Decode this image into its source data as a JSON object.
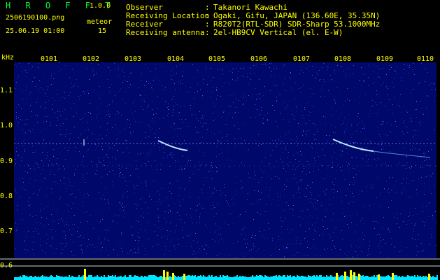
{
  "header": {
    "app_title": "H R O F F T",
    "version": "1.0.0",
    "filename": "2506190100.png",
    "meteor_label": "meteor",
    "datetime": "25.06.19 01:00",
    "meteor_count": "15",
    "info": [
      {
        "key": "Observer",
        "value": "Takanori Kawachi"
      },
      {
        "key": "Receiving Location",
        "value": "Ogaki, Gifu, JAPAN (136.60E, 35.35N)"
      },
      {
        "key": "Receiver",
        "value": "R820T2(RTL-SDR) SDR-Sharp 53.1000MHz"
      },
      {
        "key": "Receiving antenna",
        "value": "2el-HB9CV Vertical (el. E-W)"
      }
    ],
    "separator": ":"
  },
  "spectrogram": {
    "unit": "kHz",
    "y_ticks": [
      "1.1",
      "1.0",
      "0.9",
      "0.8",
      "0.7",
      "0.6"
    ],
    "x_ticks": [
      "0101",
      "0102",
      "0103",
      "0104",
      "0105",
      "0106",
      "0107",
      "0108",
      "0109",
      "0110"
    ],
    "colors": {
      "background": "#00086a",
      "noise": "#2840d8",
      "signal": "#9fd8ff",
      "bar": "#00e5ff",
      "spike": "#ffff00",
      "text": "#ffff00"
    }
  }
}
